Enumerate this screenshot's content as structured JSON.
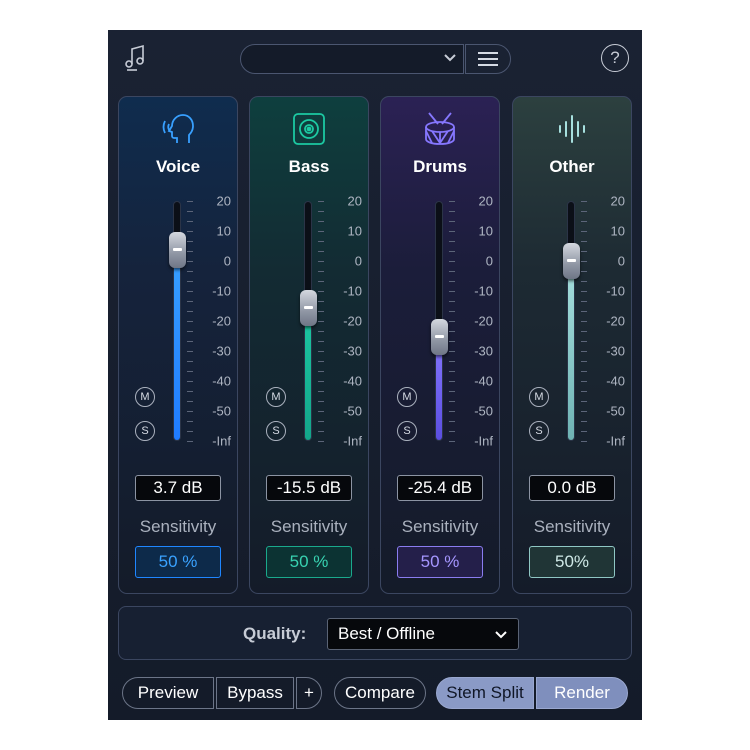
{
  "toolbar": {
    "preset_value": "",
    "help_symbol": "?",
    "music_icon": "music-notes-icon",
    "menu_icon": "hamburger-menu-icon"
  },
  "scale_labels": [
    "20",
    "10",
    "0",
    "-10",
    "-20",
    "-30",
    "-40",
    "-50",
    "-Inf"
  ],
  "stems": [
    {
      "name": "Voice",
      "icon": "voice-head-icon",
      "db": "3.7 dB",
      "level_db": 3.7,
      "sensitivity_label": "Sensitivity",
      "sensitivity": "50 %",
      "mute": "M",
      "solo": "S",
      "accent": "#1f7bff",
      "accent2": "#38a0ff",
      "sens_border": "#1f86ff",
      "sens_text": "#3aa2ff",
      "sens_bg": "#0d2a4a"
    },
    {
      "name": "Bass",
      "icon": "speaker-icon",
      "db": "-15.5 dB",
      "level_db": -15.5,
      "sensitivity_label": "Sensitivity",
      "sensitivity": "50 %",
      "mute": "M",
      "solo": "S",
      "accent": "#13a58a",
      "accent2": "#1cc9a2",
      "sens_border": "#1aa98c",
      "sens_text": "#38d2b1",
      "sens_bg": "#0c3333"
    },
    {
      "name": "Drums",
      "icon": "drum-icon",
      "db": "-25.4 dB",
      "level_db": -25.4,
      "sensitivity_label": "Sensitivity",
      "sensitivity": "50 %",
      "mute": "M",
      "solo": "S",
      "accent": "#5a4ee0",
      "accent2": "#8677ff",
      "sens_border": "#8a7cf0",
      "sens_text": "#a596ff",
      "sens_bg": "#241f4a"
    },
    {
      "name": "Other",
      "icon": "waveform-icon",
      "db": "0.0 dB",
      "level_db": 0.0,
      "sensitivity_label": "Sensitivity",
      "sensitivity": "50%",
      "mute": "M",
      "solo": "S",
      "accent": "#6fb3b4",
      "accent2": "#a7e0de",
      "sens_border": "#8fc7c4",
      "sens_text": "#cfe9e7",
      "sens_bg": "#203536"
    }
  ],
  "quality": {
    "label": "Quality:",
    "value": "Best / Offline"
  },
  "bottom": {
    "preview": "Preview",
    "bypass": "Bypass",
    "plus": "+",
    "compare": "Compare",
    "stem_split": "Stem Split",
    "render": "Render"
  }
}
